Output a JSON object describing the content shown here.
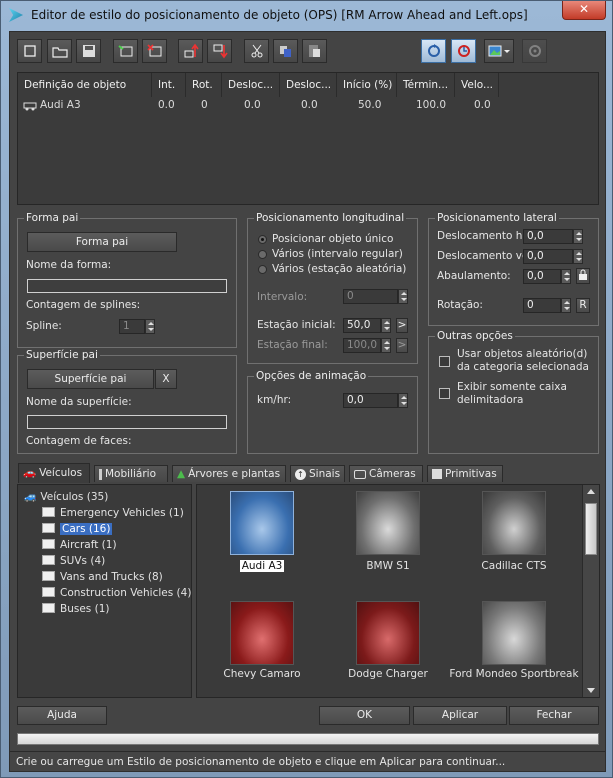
{
  "window": {
    "title": "Editor de estilo do posicionamento de objeto (OPS) [RM Arrow Ahead and Left.ops]",
    "close": "✕"
  },
  "toolbar": {
    "icons": [
      "new-file",
      "open-folder",
      "save",
      "import",
      "delete",
      "move-up",
      "move-down",
      "cut",
      "copy",
      "paste",
      "refresh",
      "rotate",
      "image-dropdown",
      "settings"
    ]
  },
  "list": {
    "columns": [
      "Definição de objeto",
      "Int.",
      "Rot.",
      "Desloc...",
      "Desloc...",
      "Início (%)",
      "Términ...",
      "Velo..."
    ],
    "rows": [
      {
        "name": "Audi A3",
        "int": "0.0",
        "rot": "0",
        "desloc1": "0.0",
        "desloc2": "0.0",
        "inicio": "50.0",
        "termino": "100.0",
        "velo": "0.0"
      }
    ]
  },
  "forma_pai": {
    "title": "Forma pai",
    "button": "Forma pai",
    "nome_label": "Nome da forma:",
    "nome_value": "",
    "contagem_label": "Contagem de splines:",
    "spline_label": "Spline:",
    "spline_value": "1"
  },
  "superficie_pai": {
    "title": "Superfície pai",
    "button": "Superfície pai",
    "x": "X",
    "nome_label": "Nome da superfície:",
    "nome_value": "",
    "contagem_label": "Contagem de faces:"
  },
  "long": {
    "title": "Posicionamento longitudinal",
    "options": [
      "Posicionar objeto único",
      "Vários (intervalo regular)",
      "Vários (estação aleatória)"
    ],
    "intervalo_label": "Intervalo:",
    "intervalo_value": "0",
    "estacao_ini_label": "Estação inicial:",
    "estacao_ini_value": "50,0",
    "estacao_fin_label": "Estação final:",
    "estacao_fin_value": "100,0",
    "arrow": ">"
  },
  "lateral": {
    "title": "Posicionamento lateral",
    "desl_hor_label": "Deslocamento hor",
    "desl_hor_value": "0,0",
    "desl_ver_label": "Deslocamento ver",
    "desl_ver_value": "0,0",
    "abaul_label": "Abaulamento:",
    "abaul_value": "0,0",
    "rot_label": "Rotação:",
    "rot_value": "0",
    "r": "R"
  },
  "anim": {
    "title": "Opções de animação",
    "kmh_label": "km/hr:",
    "kmh_value": "0,0"
  },
  "outras": {
    "title": "Outras opções",
    "chk1": [
      "Usar objetos aleatório(d)",
      "da categoria selecionada"
    ],
    "chk2": [
      "Exibir somente caixa",
      "delimitadora"
    ]
  },
  "tabs": [
    "Veículos",
    "Mobiliário",
    "Árvores e plantas",
    "Sinais",
    "Câmeras",
    "Primitivas"
  ],
  "tree": {
    "root": "Veículos (35)",
    "items": [
      "Emergency Vehicles (1)",
      "Cars (16)",
      "Aircraft (1)",
      "SUVs (4)",
      "Vans and Trucks (8)",
      "Construction Vehicles (4)",
      "Buses (1)"
    ],
    "selected": 1
  },
  "gallery": [
    "Audi A3",
    "BMW S1",
    "Cadillac CTS",
    "Chevy Camaro",
    "Dodge Charger",
    "Ford Mondeo Sportbreak"
  ],
  "buttons": {
    "ajuda": "Ajuda",
    "ok": "OK",
    "aplicar": "Aplicar",
    "fechar": "Fechar"
  },
  "status": "Crie ou carregue um Estilo de posicionamento de objeto e clique em Aplicar para continuar..."
}
